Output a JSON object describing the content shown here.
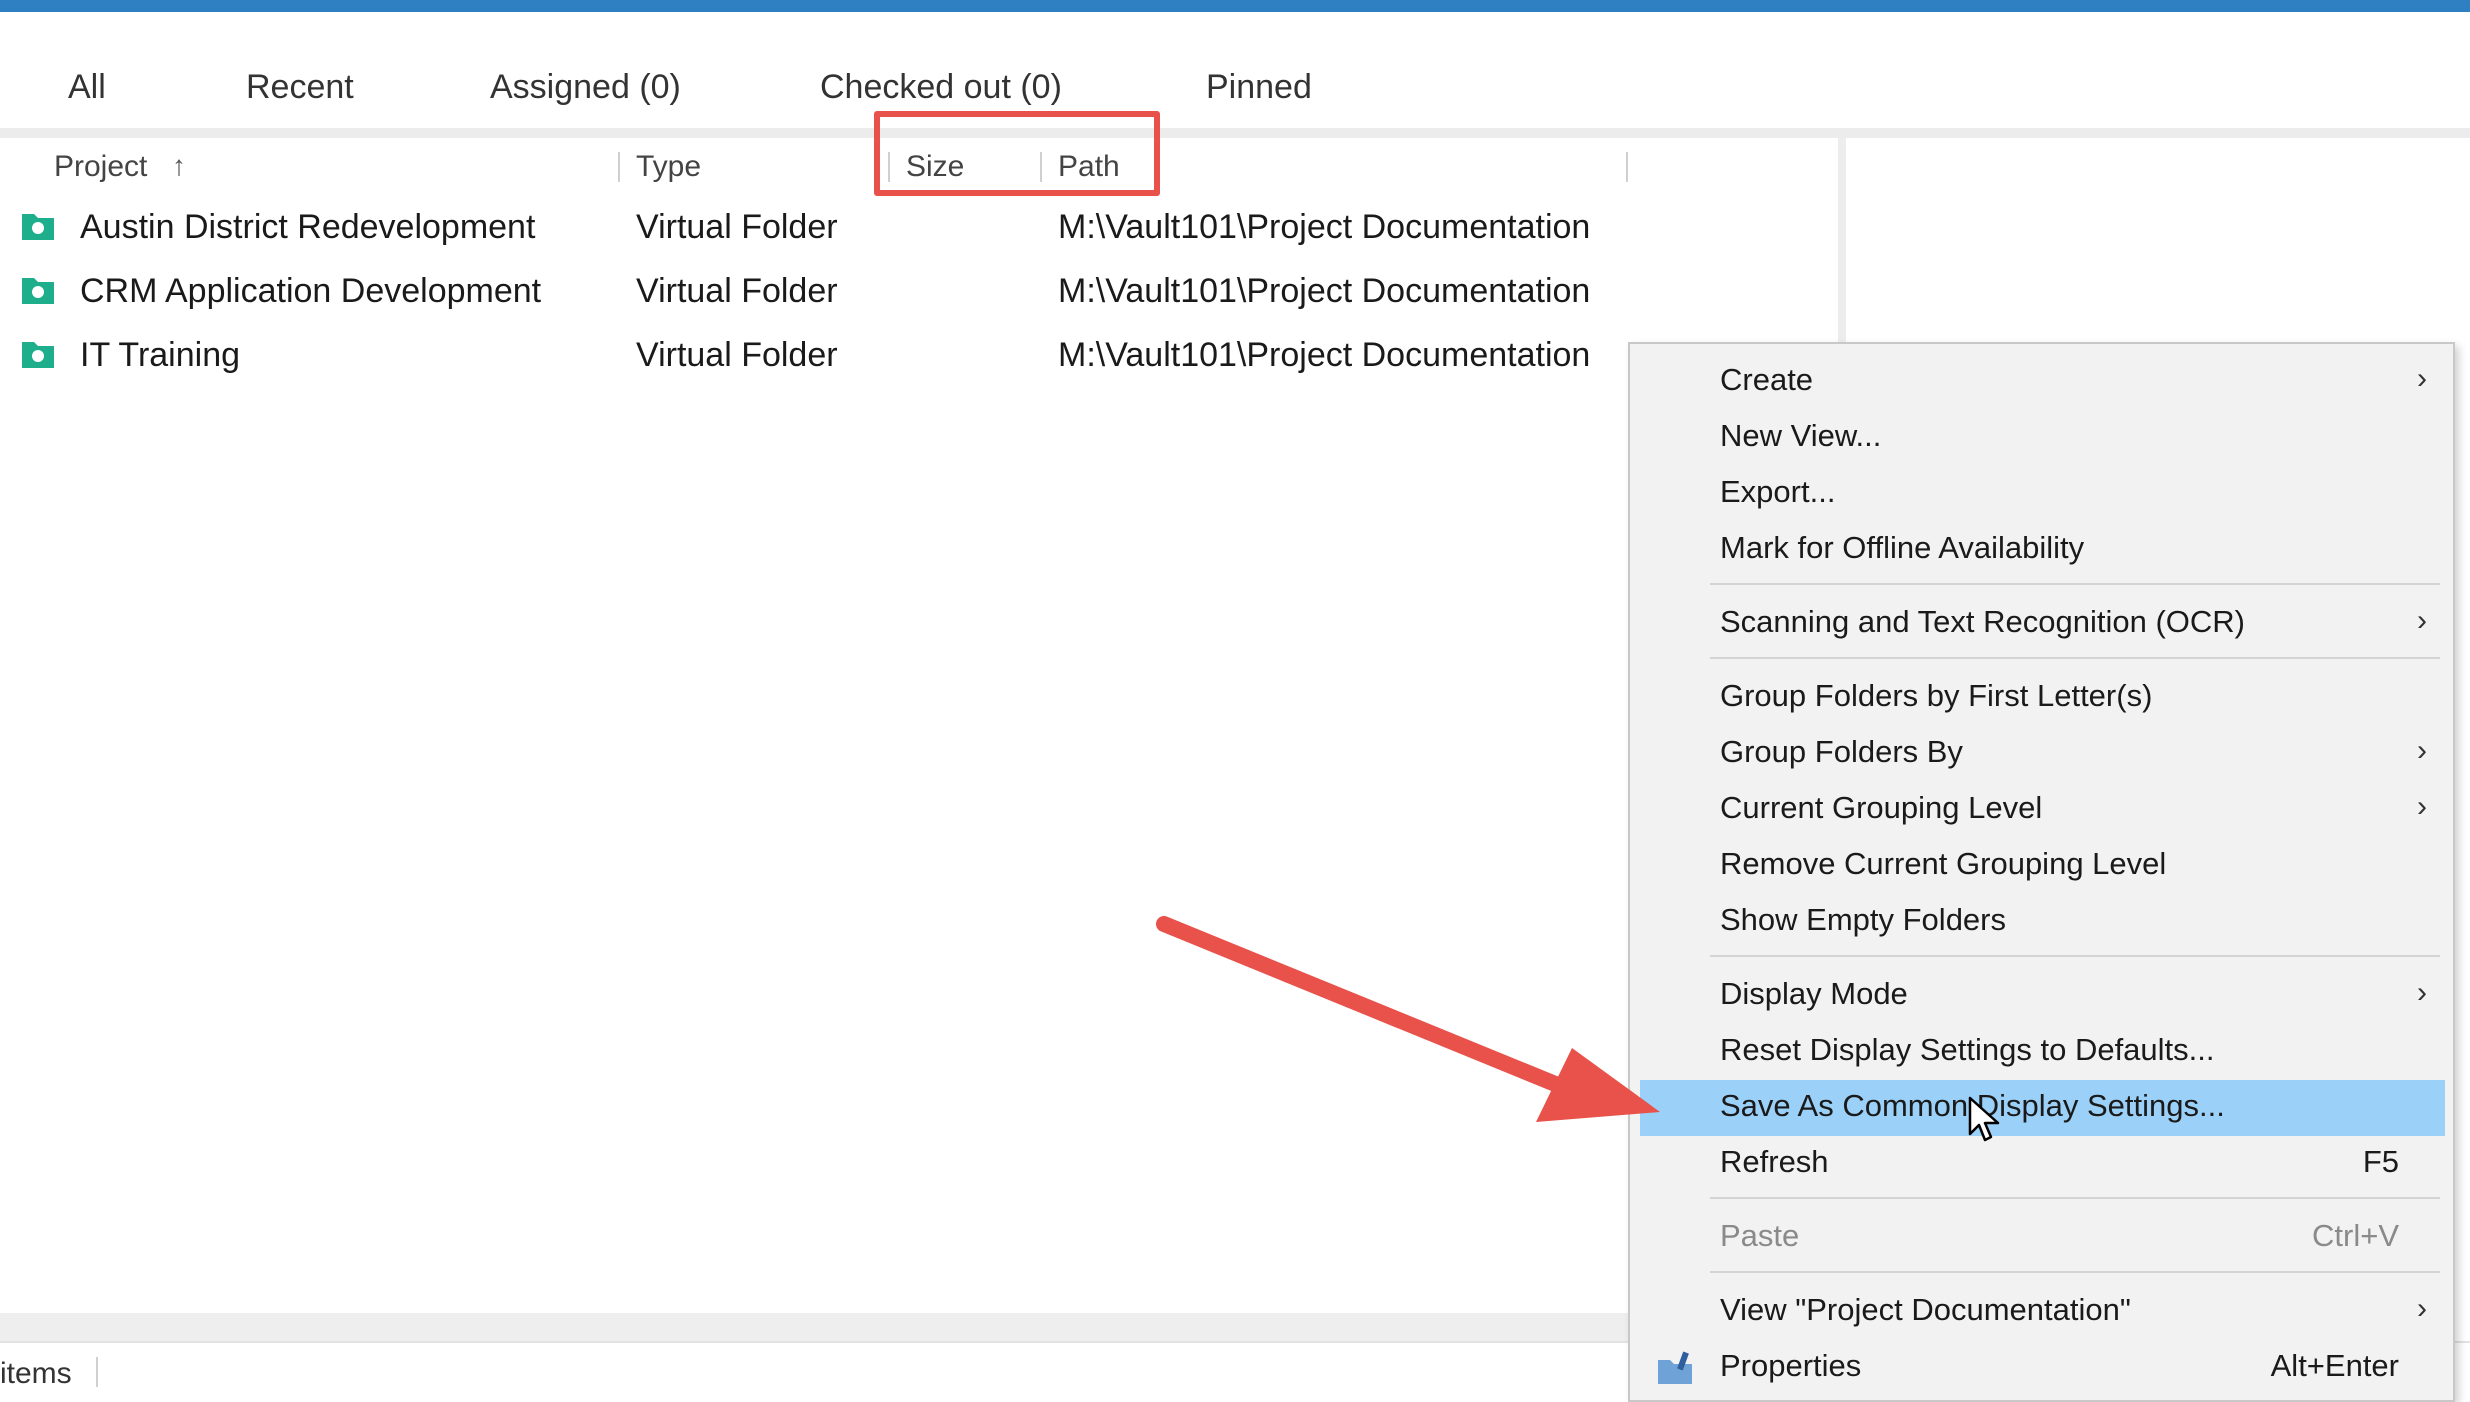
{
  "tabs": [
    {
      "label": "All"
    },
    {
      "label": "Recent"
    },
    {
      "label": "Assigned (0)"
    },
    {
      "label": "Checked out (0)"
    },
    {
      "label": "Pinned"
    }
  ],
  "columns": {
    "project": "Project",
    "sort_indicator": "↑",
    "type": "Type",
    "size": "Size",
    "path": "Path"
  },
  "rows": [
    {
      "project": "Austin District Redevelopment",
      "type": "Virtual Folder",
      "size": "",
      "path": "M:\\Vault101\\Project Documentation"
    },
    {
      "project": "CRM Application Development",
      "type": "Virtual Folder",
      "size": "",
      "path": "M:\\Vault101\\Project Documentation"
    },
    {
      "project": "IT Training",
      "type": "Virtual Folder",
      "size": "",
      "path": "M:\\Vault101\\Project Documentation"
    }
  ],
  "status": {
    "items_label": "items"
  },
  "context_menu": {
    "items": [
      {
        "label": "Create",
        "shortcut": "",
        "submenu": true
      },
      {
        "label": "New View...",
        "shortcut": "",
        "submenu": false
      },
      {
        "label": "Export...",
        "shortcut": "",
        "submenu": false
      },
      {
        "label": "Mark for Offline Availability",
        "shortcut": "",
        "submenu": false
      },
      {
        "label": "Scanning and Text Recognition (OCR)",
        "shortcut": "",
        "submenu": true
      },
      {
        "label": "Group Folders by First Letter(s)",
        "shortcut": "",
        "submenu": false
      },
      {
        "label": "Group Folders By",
        "shortcut": "",
        "submenu": true
      },
      {
        "label": "Current Grouping Level",
        "shortcut": "",
        "submenu": true
      },
      {
        "label": "Remove Current Grouping Level",
        "shortcut": "",
        "submenu": false
      },
      {
        "label": "Show Empty Folders",
        "shortcut": "",
        "submenu": false
      },
      {
        "label": "Display Mode",
        "shortcut": "",
        "submenu": true
      },
      {
        "label": "Reset Display Settings to Defaults...",
        "shortcut": "",
        "submenu": false
      },
      {
        "label": "Save As Common Display Settings...",
        "shortcut": "",
        "submenu": false,
        "selected": true
      },
      {
        "label": "Refresh",
        "shortcut": "F5",
        "submenu": false
      },
      {
        "label": "Paste",
        "shortcut": "Ctrl+V",
        "submenu": false,
        "disabled": true
      },
      {
        "label": "View \"Project Documentation\"",
        "shortcut": "",
        "submenu": true
      },
      {
        "label": "Properties",
        "shortcut": "Alt+Enter",
        "submenu": false
      }
    ],
    "submenu_glyph": "›"
  },
  "colors": {
    "title_bar": "#2f7fc3",
    "highlight_box": "#e8524a",
    "annotation_arrow": "#e8524a",
    "menu_selected": "#9bd0f8",
    "folder_icon": "#1fae8c"
  }
}
